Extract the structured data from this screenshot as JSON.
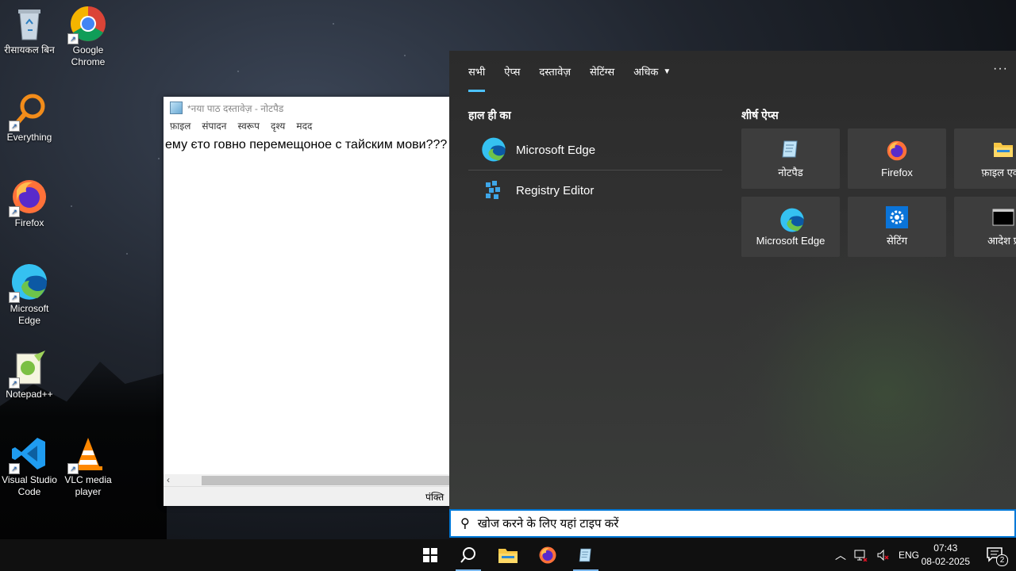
{
  "desktop": {
    "icons": [
      {
        "label": "रीसायकल बिन",
        "icon": "recycle-bin-icon"
      },
      {
        "label": "Google Chrome",
        "icon": "chrome-icon"
      },
      {
        "label": "Everything",
        "icon": "everything-icon"
      },
      {
        "label": "Firefox",
        "icon": "firefox-icon"
      },
      {
        "label": "Microsoft Edge",
        "icon": "edge-icon"
      },
      {
        "label": "Notepad++",
        "icon": "notepadpp-icon"
      },
      {
        "label": "Visual Studio Code",
        "icon": "vscode-icon"
      },
      {
        "label": "VLC media player",
        "icon": "vlc-icon"
      }
    ]
  },
  "notepad": {
    "title": "*नया पाठ दस्तावेज़ - नोटपैड",
    "menu": [
      "फ़ाइल",
      "संपादन",
      "स्वरूप",
      "दृश्य",
      "मदद"
    ],
    "content": "ему єто говно перемещоное с тайским мови??? w",
    "status": "पंक्ति"
  },
  "search": {
    "tabs": [
      "सभी",
      "ऐप्स",
      "दस्तावेज़",
      "सेटिंग्स",
      "अधिक"
    ],
    "more_label": "···",
    "recent_title": "हाल ही का",
    "recent": [
      {
        "label": "Microsoft Edge",
        "icon": "edge-icon"
      },
      {
        "label": "Registry Editor",
        "icon": "registry-editor-icon"
      }
    ],
    "top_title": "शीर्ष ऐप्स",
    "top_apps": [
      {
        "label": "नोटपैड",
        "icon": "notepad-icon"
      },
      {
        "label": "Firefox",
        "icon": "firefox-icon"
      },
      {
        "label": "फ़ाइल एक्स",
        "icon": "folder-icon"
      },
      {
        "label": "Microsoft Edge",
        "icon": "edge-icon"
      },
      {
        "label": "सेटिंग",
        "icon": "gear-icon"
      },
      {
        "label": "आदेश प्र",
        "icon": "command-prompt-icon"
      }
    ],
    "placeholder": "खोज करने के लिए यहां टाइप करें"
  },
  "taskbar": {
    "language": "ENG",
    "time": "07:43",
    "date": "08-02-2025",
    "notification_count": "2"
  },
  "colors": {
    "accent": "#4cc2ff",
    "searchbox_border": "#0078d7"
  }
}
